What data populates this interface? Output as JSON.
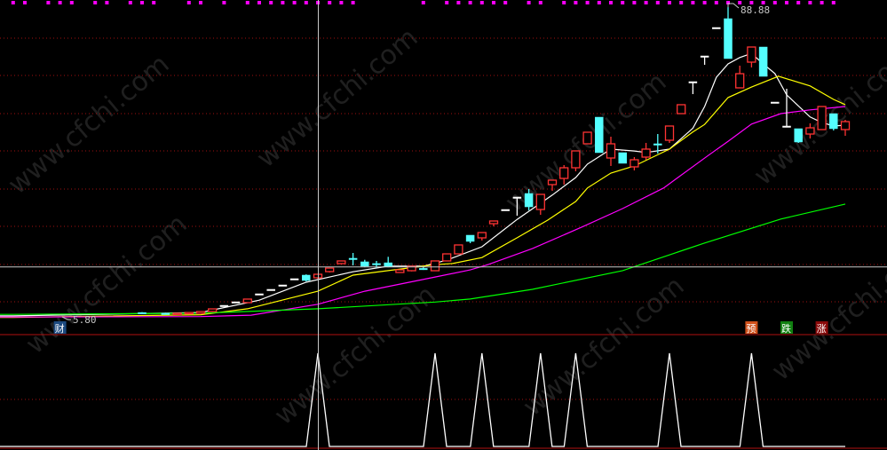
{
  "chart_data": [
    {
      "type": "candlestick",
      "title": "",
      "xlabel": "",
      "ylabel": "",
      "grid": true,
      "colors": {
        "up": "#ff3333",
        "down": "#54ffff",
        "doji": "#ffffff",
        "background": "#000000",
        "grid": "#a01010"
      },
      "price_labels": {
        "high": "88.88",
        "low": "5.80"
      },
      "candles": [
        {
          "index": -5,
          "o": 7.2,
          "h": 7.3,
          "l": 6.9,
          "c": 7.0
        },
        {
          "index": -3,
          "o": 7.0,
          "h": 7.1,
          "l": 6.8,
          "c": 6.9
        },
        {
          "index": -2,
          "o": 6.8,
          "h": 7.1,
          "l": 6.8,
          "c": 7.0
        },
        {
          "index": -1,
          "o": 6.9,
          "h": 7.3,
          "l": 6.9,
          "c": 7.2
        },
        {
          "index": 0,
          "o": 6.99,
          "h": 7.46,
          "l": 6.99,
          "c": 7.46
        },
        {
          "index": 1,
          "o": 7.46,
          "h": 8.17,
          "l": 7.3,
          "c": 8.17
        },
        {
          "index": 2,
          "o": 9.12,
          "h": 9.12,
          "l": 9.12,
          "c": 9.12
        },
        {
          "index": 3,
          "o": 10.07,
          "h": 10.07,
          "l": 10.07,
          "c": 10.07
        },
        {
          "index": 4,
          "o": 9.84,
          "h": 10.79,
          "l": 9.84,
          "c": 10.79
        },
        {
          "index": 5,
          "o": 12.21,
          "h": 12.21,
          "l": 12.21,
          "c": 12.21
        },
        {
          "index": 6,
          "o": 13.4,
          "h": 13.4,
          "l": 13.4,
          "c": 13.4
        },
        {
          "index": 7,
          "o": 14.58,
          "h": 14.58,
          "l": 14.58,
          "c": 14.58
        },
        {
          "index": 8,
          "o": 16.25,
          "h": 16.25,
          "l": 16.25,
          "c": 16.25
        },
        {
          "index": 9,
          "o": 17.2,
          "h": 17.4,
          "l": 15.5,
          "c": 15.77
        },
        {
          "index": 10,
          "o": 16.48,
          "h": 17.43,
          "l": 16.2,
          "c": 17.43
        },
        {
          "index": 11,
          "o": 18.14,
          "h": 19.09,
          "l": 17.9,
          "c": 19.09
        },
        {
          "index": 12,
          "o": 20.28,
          "h": 21.0,
          "l": 20.1,
          "c": 21.0
        },
        {
          "index": 13,
          "o": 21.71,
          "h": 23.13,
          "l": 19.81,
          "c": 21.7,
          "down": true
        },
        {
          "index": 14,
          "o": 20.76,
          "h": 21.3,
          "l": 19.3,
          "c": 19.57
        },
        {
          "index": 15,
          "o": 20.3,
          "h": 21.0,
          "l": 19.1,
          "c": 20.29,
          "down": true
        },
        {
          "index": 16,
          "o": 20.5,
          "h": 22.1,
          "l": 19.3,
          "c": 19.57
        },
        {
          "index": 17,
          "o": 17.91,
          "h": 18.62,
          "l": 17.91,
          "c": 18.62
        },
        {
          "index": 18,
          "o": 18.38,
          "h": 19.57,
          "l": 18.2,
          "c": 19.57
        },
        {
          "index": 19,
          "o": 19.0,
          "h": 19.5,
          "l": 18.6,
          "c": 18.99,
          "down": true
        },
        {
          "index": 20,
          "o": 18.38,
          "h": 21.0,
          "l": 18.38,
          "c": 21.0
        },
        {
          "index": 21,
          "o": 21.0,
          "h": 22.89,
          "l": 21.0,
          "c": 22.89
        },
        {
          "index": 22,
          "o": 22.89,
          "h": 25.27,
          "l": 22.89,
          "c": 25.27
        },
        {
          "index": 23,
          "o": 27.88,
          "h": 27.88,
          "l": 25.74,
          "c": 26.22
        },
        {
          "index": 24,
          "o": 27.17,
          "h": 28.59,
          "l": 26.45,
          "c": 28.59
        },
        {
          "index": 25,
          "o": 30.96,
          "h": 31.68,
          "l": 30.25,
          "c": 31.68
        },
        {
          "index": 26,
          "o": 34.76,
          "h": 34.76,
          "l": 34.76,
          "c": 34.76
        },
        {
          "index": 27,
          "o": 38.09,
          "h": 38.09,
          "l": 33.1,
          "c": 38.09
        },
        {
          "index": 28,
          "o": 39.04,
          "h": 40.22,
          "l": 34.53,
          "c": 35.47
        },
        {
          "index": 29,
          "o": 34.76,
          "h": 38.8,
          "l": 33.34,
          "c": 38.8
        },
        {
          "index": 30,
          "o": 41.41,
          "h": 42.6,
          "l": 39.75,
          "c": 42.6
        },
        {
          "index": 31,
          "o": 43.07,
          "h": 46.63,
          "l": 41.41,
          "c": 45.92
        },
        {
          "index": 32,
          "o": 45.92,
          "h": 50.43,
          "l": 44.97,
          "c": 50.43
        },
        {
          "index": 33,
          "o": 52.33,
          "h": 55.42,
          "l": 52.33,
          "c": 55.42
        },
        {
          "index": 34,
          "o": 59.45,
          "h": 59.45,
          "l": 49.96,
          "c": 49.96
        },
        {
          "index": 35,
          "o": 48.53,
          "h": 54.23,
          "l": 46.4,
          "c": 52.33
        },
        {
          "index": 36,
          "o": 49.96,
          "h": 49.96,
          "l": 47.11,
          "c": 47.11
        },
        {
          "index": 37,
          "o": 46.16,
          "h": 48.77,
          "l": 45.21,
          "c": 48.06
        },
        {
          "index": 38,
          "o": 48.77,
          "h": 52.57,
          "l": 48.06,
          "c": 50.91
        },
        {
          "index": 39,
          "o": 52.33,
          "h": 54.94,
          "l": 49.72,
          "c": 52.32,
          "down": true
        },
        {
          "index": 40,
          "o": 53.28,
          "h": 57.08,
          "l": 52.57,
          "c": 57.08
        },
        {
          "index": 41,
          "o": 60.4,
          "h": 62.78,
          "l": 60.4,
          "c": 62.78
        },
        {
          "index": 42,
          "o": 68.95,
          "h": 68.95,
          "l": 65.62,
          "c": 68.95
        },
        {
          "index": 43,
          "o": 75.83,
          "h": 75.83,
          "l": 73.46,
          "c": 75.83
        },
        {
          "index": 44,
          "o": 83.43,
          "h": 83.43,
          "l": 83.43,
          "c": 83.43
        },
        {
          "index": 45,
          "o": 85.8,
          "h": 88.88,
          "l": 75.12,
          "c": 75.12
        },
        {
          "index": 46,
          "o": 67.29,
          "h": 73.22,
          "l": 67.29,
          "c": 71.08
        },
        {
          "index": 47,
          "o": 74.17,
          "h": 78.21,
          "l": 72.75,
          "c": 78.21
        },
        {
          "index": 48,
          "o": 78.21,
          "h": 78.21,
          "l": 70.37,
          "c": 70.37
        },
        {
          "index": 49,
          "o": 63.49,
          "h": 63.49,
          "l": 63.49,
          "c": 63.49
        },
        {
          "index": 50,
          "o": 57.08,
          "h": 67.05,
          "l": 57.08,
          "c": 57.08
        },
        {
          "index": 51,
          "o": 56.37,
          "h": 56.37,
          "l": 52.57,
          "c": 52.81
        },
        {
          "index": 52,
          "o": 54.94,
          "h": 57.79,
          "l": 53.75,
          "c": 56.6
        },
        {
          "index": 53,
          "o": 56.13,
          "h": 62.3,
          "l": 56.13,
          "c": 62.3
        },
        {
          "index": 54,
          "o": 60.4,
          "h": 60.4,
          "l": 55.89,
          "c": 56.37
        },
        {
          "index": 55,
          "o": 56.13,
          "h": 58.74,
          "l": 54.47,
          "c": 58.26
        }
      ],
      "moving_averages": [
        {
          "color": "#ffffff",
          "points": [
            [
              -16,
              6.3
            ],
            [
              0,
              7.2
            ],
            [
              5,
              10.5
            ],
            [
              9,
              15.3
            ],
            [
              13,
              18.1
            ],
            [
              16,
              19.6
            ],
            [
              19,
              19.6
            ],
            [
              21,
              21.2
            ],
            [
              24,
              24.8
            ],
            [
              27,
              32.1
            ],
            [
              30,
              38.6
            ],
            [
              32,
              43.3
            ],
            [
              33,
              46.9
            ],
            [
              35,
              50.9
            ],
            [
              37,
              50.4
            ],
            [
              38,
              50.0
            ],
            [
              40,
              50.9
            ],
            [
              42,
              56.5
            ],
            [
              43,
              62.3
            ],
            [
              44,
              70.1
            ],
            [
              45,
              73.7
            ],
            [
              46,
              75.4
            ],
            [
              47,
              76.5
            ],
            [
              48,
              73.7
            ],
            [
              49,
              71.1
            ],
            [
              50,
              65.4
            ],
            [
              52,
              59.5
            ],
            [
              53,
              58.0
            ],
            [
              54,
              57.1
            ],
            [
              55,
              57.3
            ]
          ]
        },
        {
          "color": "#ffff00",
          "points": [
            [
              -16,
              5.9
            ],
            [
              0,
              6.6
            ],
            [
              4,
              8.2
            ],
            [
              10,
              12.9
            ],
            [
              13,
              17.2
            ],
            [
              16,
              18.4
            ],
            [
              20,
              20.0
            ],
            [
              21.5,
              20.3
            ],
            [
              24,
              21.9
            ],
            [
              27,
              27.2
            ],
            [
              29.6,
              31.9
            ],
            [
              32,
              36.9
            ],
            [
              33,
              40.5
            ],
            [
              35,
              44.5
            ],
            [
              37,
              46.4
            ],
            [
              40,
              50.9
            ],
            [
              42,
              55.5
            ],
            [
              43,
              57.5
            ],
            [
              45,
              64.7
            ],
            [
              47,
              67.5
            ],
            [
              49.3,
              70.4
            ],
            [
              52,
              67.8
            ],
            [
              54,
              64.2
            ],
            [
              55,
              62.8
            ]
          ]
        },
        {
          "color": "#ff00ff",
          "points": [
            [
              -16,
              6.0
            ],
            [
              0,
              6.1
            ],
            [
              4.3,
              6.5
            ],
            [
              10,
              9.4
            ],
            [
              14,
              12.9
            ],
            [
              20,
              16.7
            ],
            [
              23,
              18.6
            ],
            [
              24.5,
              20.0
            ],
            [
              28.3,
              24.3
            ],
            [
              32.7,
              30.3
            ],
            [
              36,
              35.0
            ],
            [
              39.5,
              40.5
            ],
            [
              43.3,
              49.2
            ],
            [
              45,
              53.0
            ],
            [
              47,
              57.6
            ],
            [
              49.5,
              60.4
            ],
            [
              52,
              61.4
            ],
            [
              55,
              62.3
            ]
          ]
        },
        {
          "color": "#00ff00",
          "points": [
            [
              -16,
              6.7
            ],
            [
              0,
              7.0
            ],
            [
              10,
              8.2
            ],
            [
              20,
              10.0
            ],
            [
              23,
              10.8
            ],
            [
              28.3,
              13.4
            ],
            [
              36,
              18.4
            ],
            [
              43,
              25.8
            ],
            [
              49.5,
              32.2
            ],
            [
              55,
              36.2
            ]
          ]
        }
      ],
      "top_markers": {
        "color": "#ff00ff",
        "indices": [
          -16,
          -15,
          -13,
          -12,
          -11,
          -9,
          -8,
          -6,
          -5,
          -4,
          -1,
          0,
          2,
          4,
          5,
          6,
          7,
          8,
          9,
          10,
          11,
          12,
          13,
          19,
          21,
          22,
          23,
          24,
          25,
          26,
          28,
          29,
          31,
          32,
          33,
          34,
          35,
          36,
          37,
          38,
          39,
          40,
          41,
          42,
          43,
          44,
          45,
          46,
          47,
          48,
          49,
          50,
          51,
          52,
          53,
          54
        ]
      },
      "signal_tags": [
        {
          "index": -12,
          "text": "财",
          "color": "#1c4a80"
        },
        {
          "index": 47,
          "text": "预",
          "color": "#d0501a"
        },
        {
          "index": 50,
          "text": "跌",
          "color": "#108010"
        },
        {
          "index": 53,
          "text": "涨",
          "color": "#8a0a0a"
        }
      ]
    },
    {
      "type": "line",
      "title": "",
      "color": "#ffffff",
      "spike_indices": [
        10,
        20,
        24,
        29,
        32,
        40,
        47
      ],
      "ylim": [
        0,
        1
      ]
    }
  ],
  "crosshair": {
    "index": 10,
    "price": 19.4
  },
  "watermark": "www.cfchi.com"
}
